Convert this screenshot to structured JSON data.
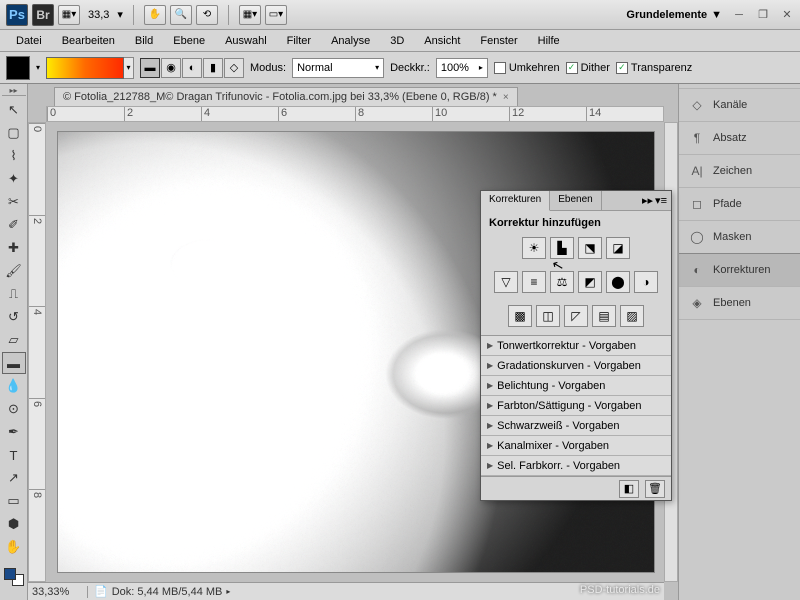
{
  "appbar": {
    "zoom": "33,3",
    "workspace": "Grundelemente"
  },
  "menu": [
    "Datei",
    "Bearbeiten",
    "Bild",
    "Ebene",
    "Auswahl",
    "Filter",
    "Analyse",
    "3D",
    "Ansicht",
    "Fenster",
    "Hilfe"
  ],
  "options": {
    "mode_label": "Modus:",
    "mode_value": "Normal",
    "opacity_label": "Deckkr.:",
    "opacity_value": "100%",
    "reverse": "Umkehren",
    "dither": "Dither",
    "transparency": "Transparenz"
  },
  "document": {
    "tab": "© Fotolia_212788_M© Dragan Trifunovic - Fotolia.com.jpg bei 33,3% (Ebene 0, RGB/8) *",
    "ruler_h": [
      "0",
      "2",
      "4",
      "6",
      "8",
      "10",
      "12",
      "14"
    ],
    "ruler_v": [
      "0",
      "2",
      "4",
      "6",
      "8"
    ],
    "status_zoom": "33,33%",
    "status_doc": "Dok: 5,44 MB/5,44 MB"
  },
  "right_strip": [
    {
      "label": "Kanäle",
      "icon": "◇"
    },
    {
      "label": "Absatz",
      "icon": "¶"
    },
    {
      "label": "Zeichen",
      "icon": "A|"
    },
    {
      "label": "Pfade",
      "icon": "◻"
    },
    {
      "label": "Masken",
      "icon": "◯"
    },
    {
      "label": "Korrekturen",
      "icon": "◐",
      "active": true
    },
    {
      "label": "Ebenen",
      "icon": "◈"
    }
  ],
  "adjustments_panel": {
    "tabs": [
      "Korrekturen",
      "Ebenen"
    ],
    "title": "Korrektur hinzufügen",
    "row1": [
      "☀",
      "▙",
      "⬔",
      "◪"
    ],
    "row2": [
      "▽",
      "≡",
      "⚖",
      "◩",
      "⬤",
      "◑"
    ],
    "row3": [
      "▩",
      "◫",
      "◸",
      "▤",
      "▨"
    ],
    "presets": [
      "Tonwertkorrektur - Vorgaben",
      "Gradationskurven - Vorgaben",
      "Belichtung - Vorgaben",
      "Farbton/Sättigung - Vorgaben",
      "Schwarzweiß - Vorgaben",
      "Kanalmixer - Vorgaben",
      "Sel. Farbkorr. - Vorgaben"
    ]
  },
  "watermark": "PSD-tutorials.de"
}
